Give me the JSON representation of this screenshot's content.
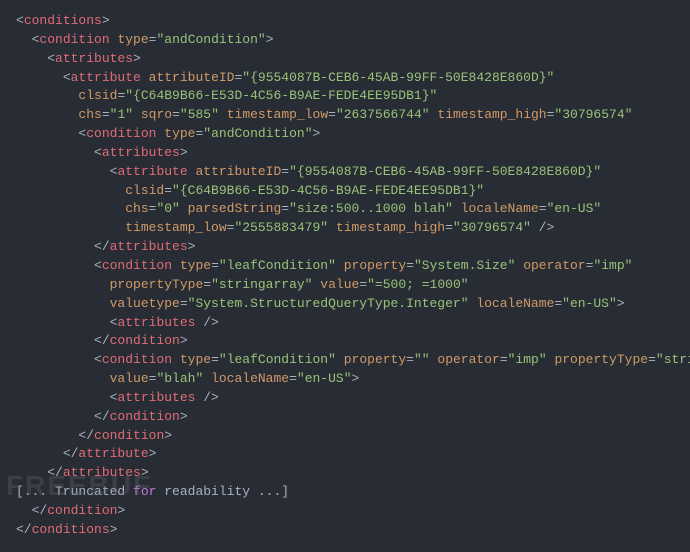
{
  "watermark": "FREEBUF",
  "code": {
    "lines": [
      [
        [
          0,
          "p",
          "<"
        ],
        [
          0,
          "tg",
          "conditions"
        ],
        [
          0,
          "p",
          ">"
        ]
      ],
      [
        [
          2,
          "p",
          "<"
        ],
        [
          0,
          "tg",
          "condition"
        ],
        [
          0,
          "p",
          " "
        ],
        [
          0,
          "at",
          "type"
        ],
        [
          0,
          "eq",
          "="
        ],
        [
          0,
          "vl",
          "\"andCondition\""
        ],
        [
          0,
          "p",
          ">"
        ]
      ],
      [
        [
          4,
          "p",
          "<"
        ],
        [
          0,
          "tg",
          "attributes"
        ],
        [
          0,
          "p",
          ">"
        ]
      ],
      [
        [
          6,
          "p",
          "<"
        ],
        [
          0,
          "tg",
          "attribute"
        ],
        [
          0,
          "p",
          " "
        ],
        [
          0,
          "at",
          "attributeID"
        ],
        [
          0,
          "eq",
          "="
        ],
        [
          0,
          "vl",
          "\"{9554087B-CEB6-45AB-99FF-50E8428E860D}\""
        ]
      ],
      [
        [
          8,
          "at",
          "clsid"
        ],
        [
          0,
          "eq",
          "="
        ],
        [
          0,
          "vl",
          "\"{C64B9B66-E53D-4C56-B9AE-FEDE4EE95DB1}\""
        ]
      ],
      [
        [
          8,
          "at",
          "chs"
        ],
        [
          0,
          "eq",
          "="
        ],
        [
          0,
          "vl",
          "\"1\""
        ],
        [
          0,
          "p",
          " "
        ],
        [
          0,
          "at",
          "sqro"
        ],
        [
          0,
          "eq",
          "="
        ],
        [
          0,
          "vl",
          "\"585\""
        ],
        [
          0,
          "p",
          " "
        ],
        [
          0,
          "at",
          "timestamp_low"
        ],
        [
          0,
          "eq",
          "="
        ],
        [
          0,
          "vl",
          "\"2637566744\""
        ],
        [
          0,
          "p",
          " "
        ],
        [
          0,
          "at",
          "timestamp_high"
        ],
        [
          0,
          "eq",
          "="
        ],
        [
          0,
          "vl",
          "\"30796574\""
        ]
      ],
      [
        [
          8,
          "p",
          "<"
        ],
        [
          0,
          "tg",
          "condition"
        ],
        [
          0,
          "p",
          " "
        ],
        [
          0,
          "at",
          "type"
        ],
        [
          0,
          "eq",
          "="
        ],
        [
          0,
          "vl",
          "\"andCondition\""
        ],
        [
          0,
          "p",
          ">"
        ]
      ],
      [
        [
          10,
          "p",
          "<"
        ],
        [
          0,
          "tg",
          "attributes"
        ],
        [
          0,
          "p",
          ">"
        ]
      ],
      [
        [
          12,
          "p",
          "<"
        ],
        [
          0,
          "tg",
          "attribute"
        ],
        [
          0,
          "p",
          " "
        ],
        [
          0,
          "at",
          "attributeID"
        ],
        [
          0,
          "eq",
          "="
        ],
        [
          0,
          "vl",
          "\"{9554087B-CEB6-45AB-99FF-50E8428E860D}\""
        ]
      ],
      [
        [
          14,
          "at",
          "clsid"
        ],
        [
          0,
          "eq",
          "="
        ],
        [
          0,
          "vl",
          "\"{C64B9B66-E53D-4C56-B9AE-FEDE4EE95DB1}\""
        ]
      ],
      [
        [
          14,
          "at",
          "chs"
        ],
        [
          0,
          "eq",
          "="
        ],
        [
          0,
          "vl",
          "\"0\""
        ],
        [
          0,
          "p",
          " "
        ],
        [
          0,
          "at",
          "parsedString"
        ],
        [
          0,
          "eq",
          "="
        ],
        [
          0,
          "vl",
          "\"size:500..1000 blah\""
        ],
        [
          0,
          "p",
          " "
        ],
        [
          0,
          "at",
          "localeName"
        ],
        [
          0,
          "eq",
          "="
        ],
        [
          0,
          "vl",
          "\"en-US\""
        ]
      ],
      [
        [
          14,
          "at",
          "timestamp_low"
        ],
        [
          0,
          "eq",
          "="
        ],
        [
          0,
          "vl",
          "\"2555883479\""
        ],
        [
          0,
          "p",
          " "
        ],
        [
          0,
          "at",
          "timestamp_high"
        ],
        [
          0,
          "eq",
          "="
        ],
        [
          0,
          "vl",
          "\"30796574\""
        ],
        [
          0,
          "p",
          " />"
        ]
      ],
      [
        [
          10,
          "p",
          "</"
        ],
        [
          0,
          "tg",
          "attributes"
        ],
        [
          0,
          "p",
          ">"
        ]
      ],
      [
        [
          10,
          "p",
          "<"
        ],
        [
          0,
          "tg",
          "condition"
        ],
        [
          0,
          "p",
          " "
        ],
        [
          0,
          "at",
          "type"
        ],
        [
          0,
          "eq",
          "="
        ],
        [
          0,
          "vl",
          "\"leafCondition\""
        ],
        [
          0,
          "p",
          " "
        ],
        [
          0,
          "at",
          "property"
        ],
        [
          0,
          "eq",
          "="
        ],
        [
          0,
          "vl",
          "\"System.Size\""
        ],
        [
          0,
          "p",
          " "
        ],
        [
          0,
          "at",
          "operator"
        ],
        [
          0,
          "eq",
          "="
        ],
        [
          0,
          "vl",
          "\"imp\""
        ]
      ],
      [
        [
          12,
          "at",
          "propertyType"
        ],
        [
          0,
          "eq",
          "="
        ],
        [
          0,
          "vl",
          "\"stringarray\""
        ],
        [
          0,
          "p",
          " "
        ],
        [
          0,
          "at",
          "value"
        ],
        [
          0,
          "eq",
          "="
        ],
        [
          0,
          "vl",
          "\"=500; =1000\""
        ]
      ],
      [
        [
          12,
          "at",
          "valuetype"
        ],
        [
          0,
          "eq",
          "="
        ],
        [
          0,
          "vl",
          "\"System.StructuredQueryType.Integer\""
        ],
        [
          0,
          "p",
          " "
        ],
        [
          0,
          "at",
          "localeName"
        ],
        [
          0,
          "eq",
          "="
        ],
        [
          0,
          "vl",
          "\"en-US\""
        ],
        [
          0,
          "p",
          ">"
        ]
      ],
      [
        [
          12,
          "p",
          "<"
        ],
        [
          0,
          "tg",
          "attributes"
        ],
        [
          0,
          "p",
          " />"
        ]
      ],
      [
        [
          10,
          "p",
          "</"
        ],
        [
          0,
          "tg",
          "condition"
        ],
        [
          0,
          "p",
          ">"
        ]
      ],
      [
        [
          10,
          "p",
          "<"
        ],
        [
          0,
          "tg",
          "condition"
        ],
        [
          0,
          "p",
          " "
        ],
        [
          0,
          "at",
          "type"
        ],
        [
          0,
          "eq",
          "="
        ],
        [
          0,
          "vl",
          "\"leafCondition\""
        ],
        [
          0,
          "p",
          " "
        ],
        [
          0,
          "at",
          "property"
        ],
        [
          0,
          "eq",
          "="
        ],
        [
          0,
          "vl",
          "\"\""
        ],
        [
          0,
          "p",
          " "
        ],
        [
          0,
          "at",
          "operator"
        ],
        [
          0,
          "eq",
          "="
        ],
        [
          0,
          "vl",
          "\"imp\""
        ],
        [
          0,
          "p",
          " "
        ],
        [
          0,
          "at",
          "propertyType"
        ],
        [
          0,
          "eq",
          "="
        ],
        [
          0,
          "vl",
          "\"string\""
        ]
      ],
      [
        [
          12,
          "at",
          "value"
        ],
        [
          0,
          "eq",
          "="
        ],
        [
          0,
          "vl",
          "\"blah\""
        ],
        [
          0,
          "p",
          " "
        ],
        [
          0,
          "at",
          "localeName"
        ],
        [
          0,
          "eq",
          "="
        ],
        [
          0,
          "vl",
          "\"en-US\""
        ],
        [
          0,
          "p",
          ">"
        ]
      ],
      [
        [
          12,
          "p",
          "<"
        ],
        [
          0,
          "tg",
          "attributes"
        ],
        [
          0,
          "p",
          " />"
        ]
      ],
      [
        [
          10,
          "p",
          "</"
        ],
        [
          0,
          "tg",
          "condition"
        ],
        [
          0,
          "p",
          ">"
        ]
      ],
      [
        [
          8,
          "p",
          "</"
        ],
        [
          0,
          "tg",
          "condition"
        ],
        [
          0,
          "p",
          ">"
        ]
      ],
      [
        [
          6,
          "p",
          "</"
        ],
        [
          0,
          "tg",
          "attribute"
        ],
        [
          0,
          "p",
          ">"
        ]
      ],
      [
        [
          4,
          "p",
          "</"
        ],
        [
          0,
          "tg",
          "attributes"
        ],
        [
          0,
          "p",
          ">"
        ]
      ],
      [
        [
          0,
          "p",
          "[... Truncated "
        ],
        [
          0,
          "kw",
          "for"
        ],
        [
          0,
          "p",
          " readability ...]"
        ]
      ],
      [
        [
          2,
          "p",
          "</"
        ],
        [
          0,
          "tg",
          "condition"
        ],
        [
          0,
          "p",
          ">"
        ]
      ],
      [
        [
          0,
          "p",
          "</"
        ],
        [
          0,
          "tg",
          "conditions"
        ],
        [
          0,
          "p",
          ">"
        ]
      ]
    ]
  }
}
